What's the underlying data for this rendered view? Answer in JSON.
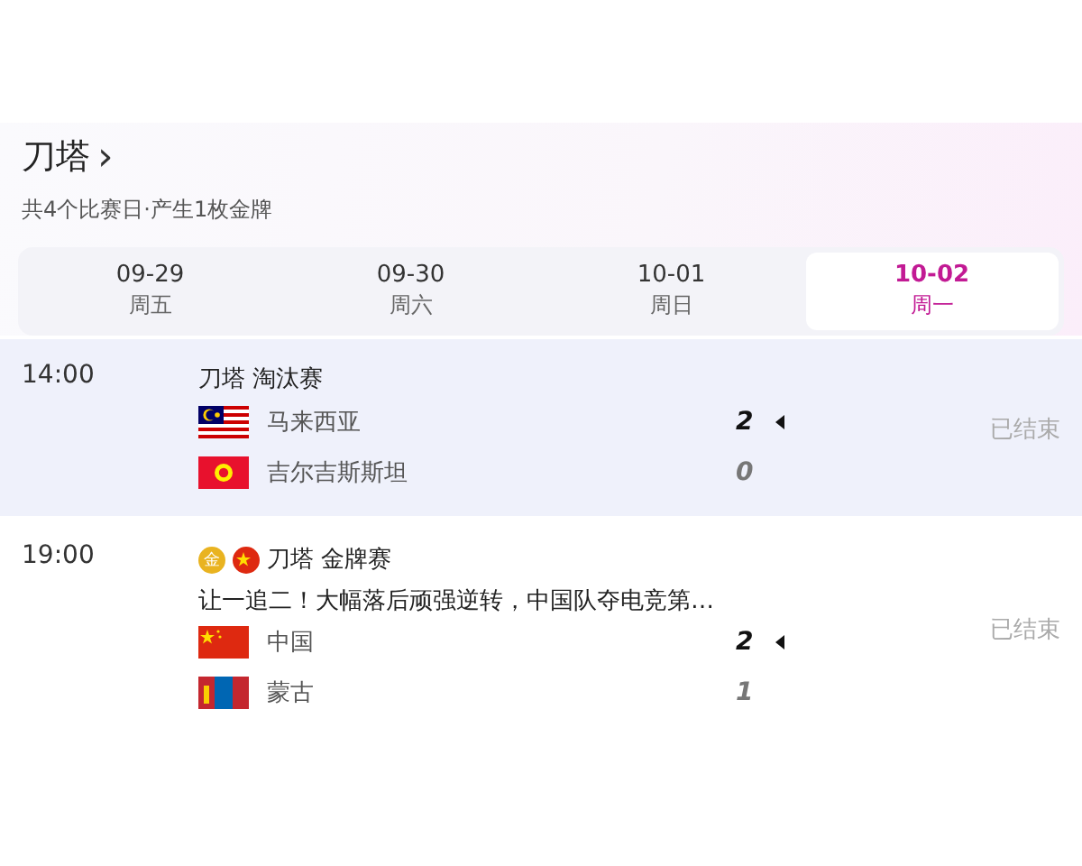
{
  "header": {
    "title": "刀塔",
    "chevron": "›",
    "subtitle": "共4个比赛日·产生1枚金牌"
  },
  "date_tabs": [
    {
      "date": "09-29",
      "weekday": "周五",
      "selected": false
    },
    {
      "date": "09-30",
      "weekday": "周六",
      "selected": false
    },
    {
      "date": "10-01",
      "weekday": "周日",
      "selected": false
    },
    {
      "date": "10-02",
      "weekday": "周一",
      "selected": true
    }
  ],
  "matches": [
    {
      "time": "14:00",
      "title": "刀塔 淘汰赛",
      "highlighted": true,
      "status": "已结束",
      "teams": [
        {
          "name": "马来西亚",
          "flag": {
            "kind": "malaysia"
          },
          "score": "2",
          "winner": true
        },
        {
          "name": "吉尔吉斯斯坦",
          "flag": {
            "kind": "kyrgyzstan"
          },
          "score": "0",
          "winner": false
        }
      ]
    },
    {
      "time": "19:00",
      "medal": "金",
      "team_flag": {
        "kind": "china"
      },
      "title": "刀塔 金牌赛",
      "headline": "让一追二！大幅落后顽强逆转，中国队夺电竞第…",
      "highlighted": false,
      "status": "已结束",
      "teams": [
        {
          "name": "中国",
          "flag": {
            "kind": "china"
          },
          "score": "2",
          "winner": true
        },
        {
          "name": "蒙古",
          "flag": {
            "kind": "mongolia"
          },
          "score": "1",
          "winner": false
        }
      ]
    }
  ]
}
